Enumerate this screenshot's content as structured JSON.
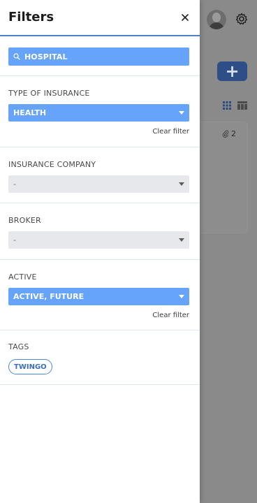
{
  "drawer": {
    "title": "Filters",
    "close_icon": "close-icon"
  },
  "search": {
    "icon": "search-icon",
    "value": "HOSPITAL"
  },
  "filters": {
    "type_of_insurance": {
      "label": "TYPE OF INSURANCE",
      "value": "HEALTH",
      "clear_label": "Clear filter"
    },
    "insurance_company": {
      "label": "INSURANCE COMPANY",
      "value": "-"
    },
    "broker": {
      "label": "BROKER",
      "value": "-"
    },
    "active": {
      "label": "ACTIVE",
      "value": "ACTIVE, FUTURE",
      "clear_label": "Clear filter"
    },
    "tags": {
      "label": "TAGS",
      "items": [
        "TWINGO"
      ]
    }
  },
  "background": {
    "add_button_label": "+",
    "attachment_count": "2",
    "icons": [
      "avatar",
      "gear-icon",
      "grid-view-icon",
      "table-view-icon",
      "paperclip-icon"
    ]
  },
  "colors": {
    "accent": "#66a3fb",
    "header_border": "#4f7fc4",
    "tag_border": "#4f86d8",
    "empty_select": "#e7e8ec",
    "overlay": "#8a8a8a"
  }
}
